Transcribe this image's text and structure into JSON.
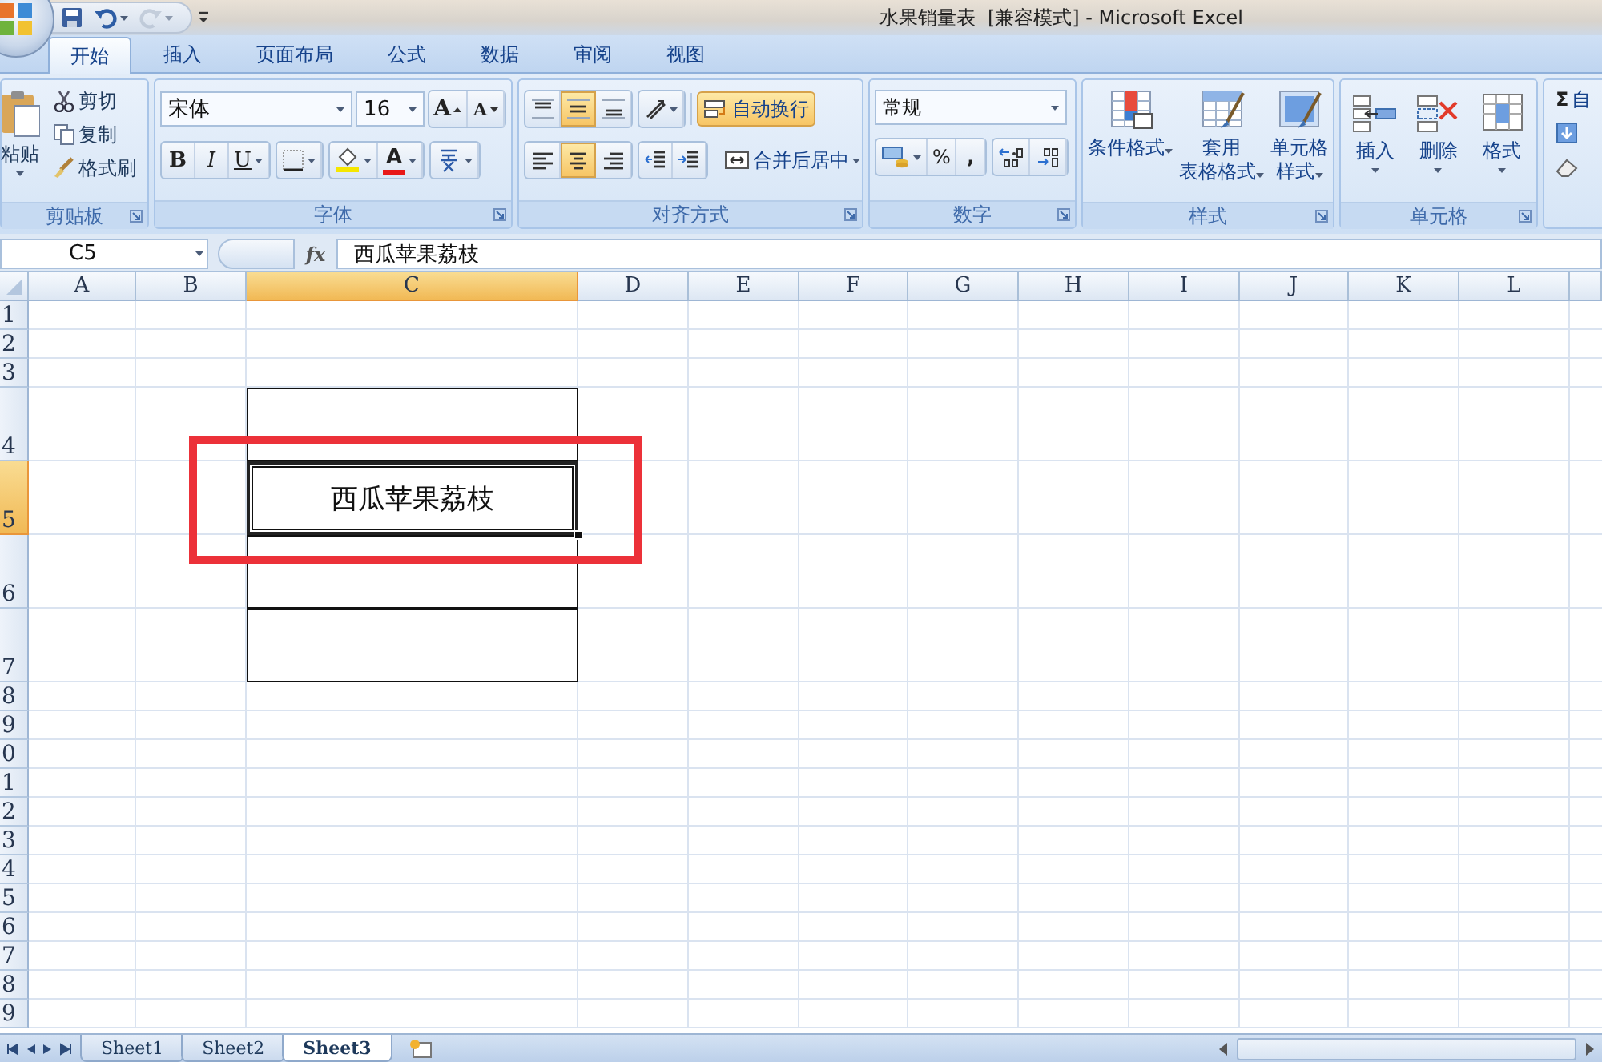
{
  "window": {
    "title": "水果销量表  [兼容模式] - Microsoft Excel"
  },
  "quick_access": [
    {
      "kind": "save",
      "disabled": false
    },
    {
      "kind": "undo",
      "disabled": false
    },
    {
      "kind": "redo",
      "disabled": true
    },
    {
      "kind": "customize",
      "disabled": false
    }
  ],
  "tabs": [
    {
      "label": "开始",
      "selected": true
    },
    {
      "label": "插入",
      "selected": false
    },
    {
      "label": "页面布局",
      "selected": false
    },
    {
      "label": "公式",
      "selected": false
    },
    {
      "label": "数据",
      "selected": false
    },
    {
      "label": "审阅",
      "selected": false
    },
    {
      "label": "视图",
      "selected": false
    }
  ],
  "ribbon": {
    "clipboard": {
      "label": "剪贴板",
      "paste": "粘贴",
      "cut": "剪切",
      "copy": "复制",
      "format_painter": "格式刷"
    },
    "font": {
      "label": "字体",
      "font_name": "宋体",
      "font_size": "16",
      "grow": "A",
      "shrink": "A",
      "bold": "B",
      "italic": "I",
      "underline": "U",
      "font_color": "A"
    },
    "alignment": {
      "label": "对齐方式",
      "vertical": [
        {
          "selected": false
        },
        {
          "selected": true
        },
        {
          "selected": false
        }
      ],
      "horizontal": [
        {
          "selected": false
        },
        {
          "selected": true
        },
        {
          "selected": false
        }
      ],
      "wrap_text": {
        "label": "自动换行",
        "on": true
      },
      "merge": "合并后居中"
    },
    "number": {
      "label": "数字",
      "format": "常规",
      "percent": "%",
      "comma": ","
    },
    "styles": {
      "label": "样式",
      "buttons": [
        {
          "kind": "conditional",
          "lines": [
            "条件格式"
          ]
        },
        {
          "kind": "table",
          "lines": [
            "套用",
            "表格格式"
          ]
        },
        {
          "kind": "cell",
          "lines": [
            "单元格",
            "样式"
          ]
        }
      ]
    },
    "cells": {
      "label": "单元格",
      "buttons": [
        {
          "kind": "insert",
          "label": "插入"
        },
        {
          "kind": "delete",
          "label": "删除"
        },
        {
          "kind": "format",
          "label": "格式"
        }
      ]
    },
    "editing": {
      "sum": "Σ",
      "autosum": "自"
    }
  },
  "formula_bar": {
    "name_box": "C5",
    "function_button": "fx",
    "formula": "西瓜苹果荔枝"
  },
  "sheet": {
    "columns": [
      {
        "label": "A",
        "selected": false
      },
      {
        "label": "B",
        "selected": false
      },
      {
        "label": "C",
        "selected": true
      },
      {
        "label": "D",
        "selected": false
      },
      {
        "label": "E",
        "selected": false
      },
      {
        "label": "F",
        "selected": false
      },
      {
        "label": "G",
        "selected": false
      },
      {
        "label": "H",
        "selected": false
      },
      {
        "label": "I",
        "selected": false
      },
      {
        "label": "J",
        "selected": false
      },
      {
        "label": "K",
        "selected": false
      },
      {
        "label": "L",
        "selected": false
      }
    ],
    "rows": [
      {
        "label": "1",
        "selected": false,
        "outlined": false
      },
      {
        "label": "2",
        "selected": false,
        "outlined": false
      },
      {
        "label": "3",
        "selected": false,
        "outlined": false
      },
      {
        "label": "4",
        "selected": false,
        "outlined": true
      },
      {
        "label": "5",
        "selected": true,
        "outlined": true
      },
      {
        "label": "6",
        "selected": false,
        "outlined": true
      },
      {
        "label": "7",
        "selected": false,
        "outlined": true
      },
      {
        "label": "8",
        "selected": false,
        "outlined": false
      },
      {
        "label": "9",
        "selected": false,
        "outlined": false
      },
      {
        "label": "0",
        "selected": false,
        "outlined": false
      },
      {
        "label": "1",
        "selected": false,
        "outlined": false
      },
      {
        "label": "2",
        "selected": false,
        "outlined": false
      },
      {
        "label": "3",
        "selected": false,
        "outlined": false
      },
      {
        "label": "4",
        "selected": false,
        "outlined": false
      },
      {
        "label": "5",
        "selected": false,
        "outlined": false
      },
      {
        "label": "6",
        "selected": false,
        "outlined": false
      },
      {
        "label": "7",
        "selected": false,
        "outlined": false
      },
      {
        "label": "8",
        "selected": false,
        "outlined": false
      },
      {
        "label": "9",
        "selected": false,
        "outlined": false
      }
    ],
    "active_cell_value": "西瓜苹果荔枝"
  },
  "sheet_tabs": [
    {
      "label": "Sheet1",
      "selected": false
    },
    {
      "label": "Sheet2",
      "selected": false
    },
    {
      "label": "Sheet3",
      "selected": true
    }
  ]
}
